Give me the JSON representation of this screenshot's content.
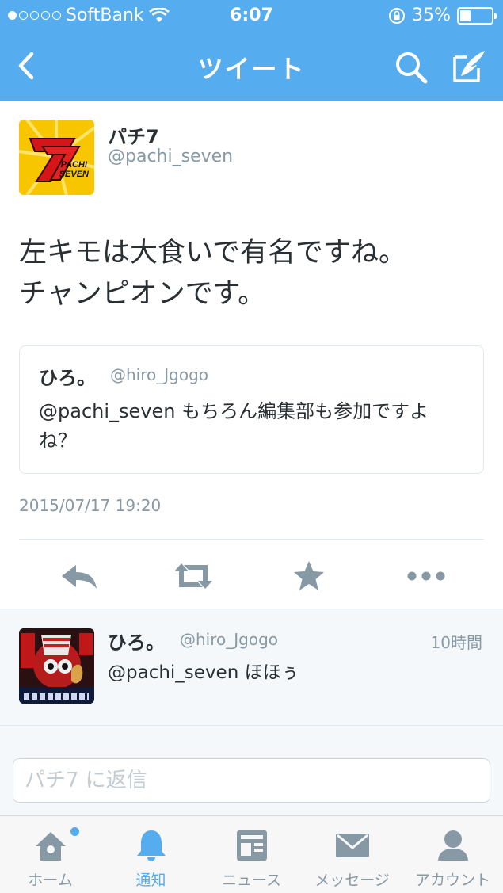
{
  "status_bar": {
    "carrier": "SoftBank",
    "time": "6:07",
    "battery_percent": "35%",
    "battery_level": 0.35,
    "signal_dots_filled": 1,
    "signal_dots_total": 5
  },
  "nav": {
    "title": "ツイート",
    "back_icon": "chevron-left-icon",
    "search_icon": "search-icon",
    "compose_icon": "compose-icon"
  },
  "tweet": {
    "user_name": "パチ7",
    "user_handle": "@pachi_seven",
    "avatar_text_1": "PACHI",
    "avatar_text_2": "SEVEN",
    "text_line1": "左キモは大食いで有名ですね。",
    "text_line2": "チャンピオンです。",
    "quote": {
      "name": "ひろ。",
      "handle": "@hiro_Jgogo",
      "text": "@pachi_seven もちろん編集部も参加ですよね？"
    },
    "timestamp": "2015/07/17 19:20",
    "actions": [
      "reply-icon",
      "retweet-icon",
      "favorite-icon",
      "more-icon"
    ]
  },
  "replies": [
    {
      "name": "ひろ。",
      "handle": "@hiro_Jgogo",
      "time": "10時間",
      "text": "@pachi_seven ほほぅ"
    }
  ],
  "composer": {
    "placeholder": "パチ7 に返信"
  },
  "tabbar": {
    "tabs": [
      {
        "label": "ホーム",
        "icon": "home-icon",
        "active": false,
        "badge": true
      },
      {
        "label": "通知",
        "icon": "bell-icon",
        "active": true,
        "badge": false
      },
      {
        "label": "ニュース",
        "icon": "news-icon",
        "active": false,
        "badge": false
      },
      {
        "label": "メッセージ",
        "icon": "envelope-icon",
        "active": false,
        "badge": false
      },
      {
        "label": "アカウント",
        "icon": "person-icon",
        "active": false,
        "badge": false
      }
    ]
  },
  "colors": {
    "brand": "#55acee",
    "text": "#292f33",
    "secondary": "#8899a6",
    "border": "#e1e8ed"
  }
}
